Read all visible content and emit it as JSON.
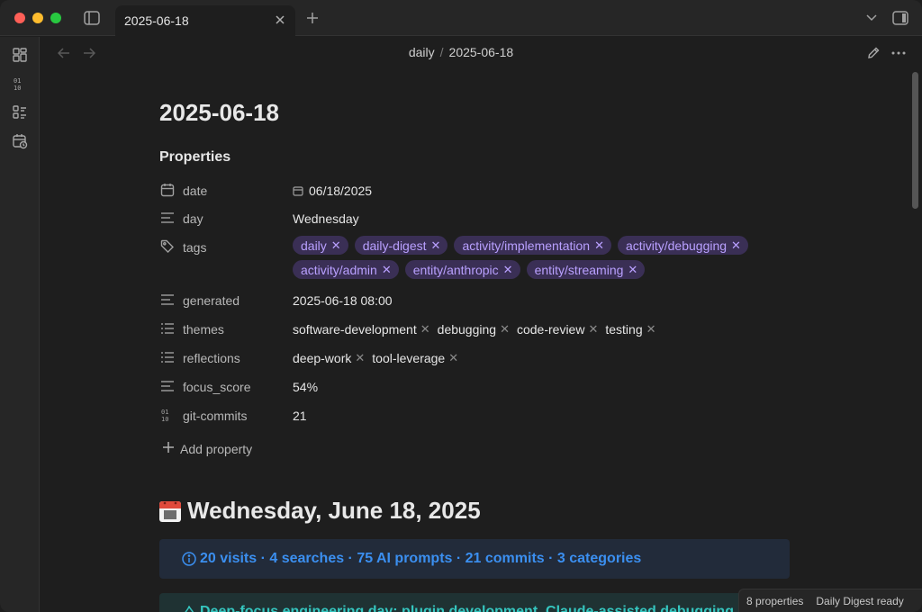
{
  "tab": {
    "title": "2025-06-18"
  },
  "breadcrumb": {
    "folder": "daily",
    "separator": "/",
    "file": "2025-06-18"
  },
  "note": {
    "title": "2025-06-18"
  },
  "properties": {
    "heading": "Properties",
    "date": {
      "key": "date",
      "value": "06/18/2025"
    },
    "day": {
      "key": "day",
      "value": "Wednesday"
    },
    "tags": {
      "key": "tags",
      "items": [
        "daily",
        "daily-digest",
        "activity/implementation",
        "activity/debugging",
        "activity/admin",
        "entity/anthropic",
        "entity/streaming"
      ]
    },
    "generated": {
      "key": "generated",
      "value": "2025-06-18 08:00"
    },
    "themes": {
      "key": "themes",
      "items": [
        "software-development",
        "debugging",
        "code-review",
        "testing"
      ]
    },
    "reflections": {
      "key": "reflections",
      "items": [
        "deep-work",
        "tool-leverage"
      ]
    },
    "focus_score": {
      "key": "focus_score",
      "value": "54%"
    },
    "git_commits": {
      "key": "git-commits",
      "value": "21"
    },
    "add_label": "Add property"
  },
  "body": {
    "heading": "Wednesday, June 18, 2025",
    "info_callout": "20 visits · 4 searches · 75 AI prompts · 21 commits · 3 categories",
    "tip_callout": "Deep-focus engineering day: plugin development, Claude-assisted debugging"
  },
  "status": {
    "properties": "8 properties",
    "digest": "Daily Digest ready"
  },
  "colors": {
    "tag_bg": "#3a2f55",
    "tag_fg": "#b9a0ff",
    "info": "#3b8ff0",
    "tip": "#35c7c0"
  }
}
